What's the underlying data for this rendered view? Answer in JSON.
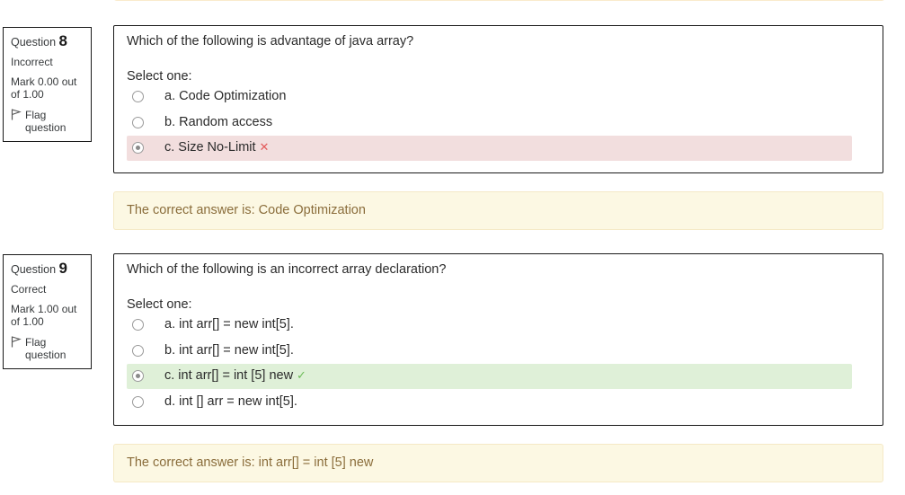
{
  "questions": [
    {
      "number_prefix": "Question",
      "number": "8",
      "state": "Incorrect",
      "grade": "Mark 0.00 out of 1.00",
      "flag_label": "Flag question",
      "text": "Which of the following is advantage of java array?",
      "prompt": "Select one:",
      "answers": [
        {
          "label": "a. Code Optimization",
          "selected": false
        },
        {
          "label": "b. Random access",
          "selected": false
        },
        {
          "label": "c. Size No-Limit",
          "selected": true,
          "result": "incorrect"
        }
      ],
      "feedback": "The correct answer is: Code Optimization"
    },
    {
      "number_prefix": "Question",
      "number": "9",
      "state": "Correct",
      "grade": "Mark 1.00 out of 1.00",
      "flag_label": "Flag question",
      "text": "Which of the following is an incorrect array declaration?",
      "prompt": "Select one:",
      "answers": [
        {
          "label": "a. int arr[] = new int[5].",
          "selected": false
        },
        {
          "label": "b. int arr[] = new int[5].",
          "selected": false
        },
        {
          "label": "c. int arr[] = int [5] new",
          "selected": true,
          "result": "correct"
        },
        {
          "label": "d. int [] arr = new int[5].",
          "selected": false
        }
      ],
      "feedback": "The correct answer is: int arr[] = int [5] new"
    }
  ],
  "marks": {
    "incorrect_icon": "cross-icon",
    "correct_icon": "check-icon"
  },
  "colors": {
    "incorrect_bg": "#f2dede",
    "correct_bg": "#dff0d8",
    "feedback_bg": "#fcf8e3",
    "feedback_text": "#8a6d3b"
  }
}
